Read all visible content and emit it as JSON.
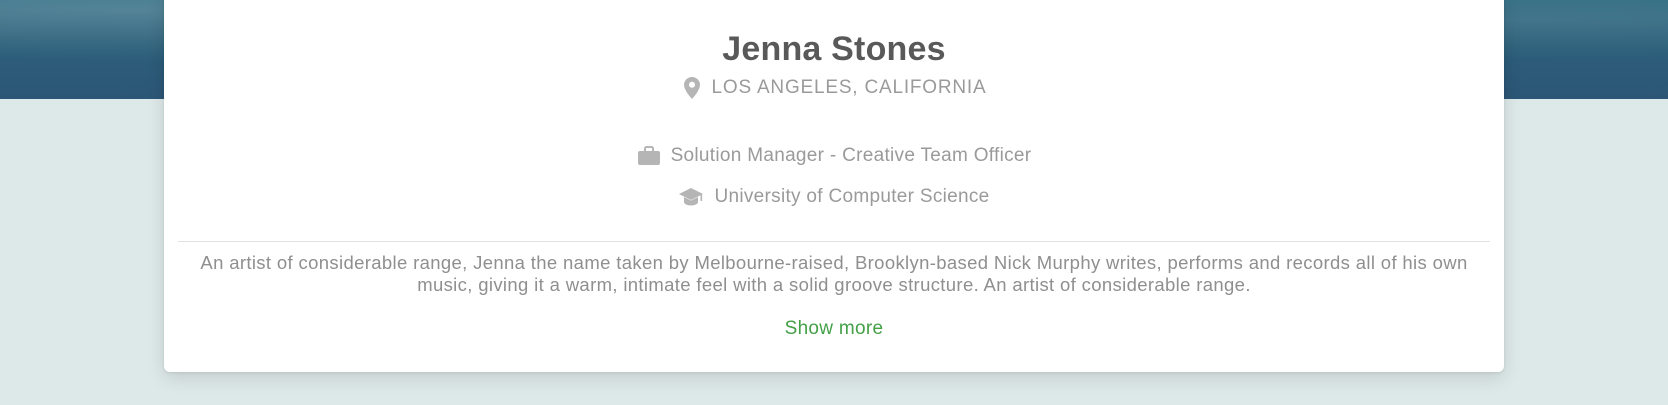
{
  "profile": {
    "name": "Jenna Stones",
    "location": "LOS ANGELES, CALIFORNIA",
    "job": "Solution Manager - Creative Team Officer",
    "education": "University of Computer Science",
    "bio": "An artist of considerable range, Jenna the name taken by Melbourne-raised, Brooklyn-based Nick Murphy writes, performs and records all of his own music, giving it a warm, intimate feel with a solid groove structure. An artist of considerable range.",
    "show_more_label": "Show more"
  },
  "icons": {
    "location": "location-pin-icon",
    "job": "briefcase-icon",
    "education": "graduation-cap-icon"
  },
  "colors": {
    "page_background": "#dde9e8",
    "hero_background": "#2d5f7a",
    "card_background": "#ffffff",
    "name_text": "#595959",
    "secondary_text": "#9a9a9a",
    "link_accent": "#43a047"
  }
}
